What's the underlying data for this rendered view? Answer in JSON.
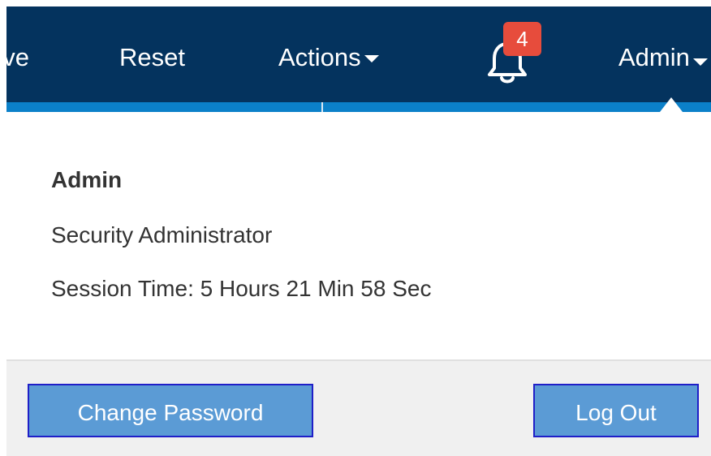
{
  "navbar": {
    "clipped_item": "ve",
    "reset_label": "Reset",
    "actions_label": "Actions",
    "notifications_count": "4",
    "admin_label": "Admin"
  },
  "user_menu": {
    "name": "Admin",
    "role": "Security Administrator",
    "session_time": "Session Time: 5 Hours 21 Min 58 Sec",
    "change_password_label": "Change Password",
    "logout_label": "Log Out"
  },
  "colors": {
    "navbar_bg": "#04335e",
    "navbar_accent": "#0b80c9",
    "badge": "#e74c3c",
    "button_bg": "#5b9bd5",
    "button_border": "#1f1fc8"
  }
}
